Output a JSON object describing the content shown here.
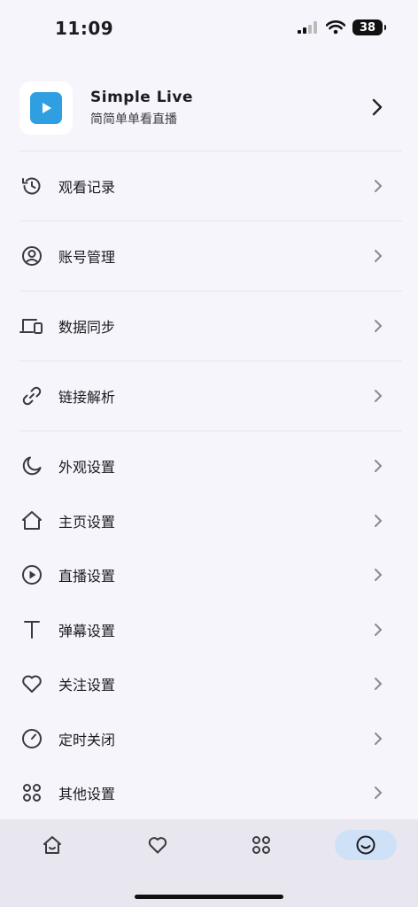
{
  "status_bar": {
    "time": "11:09",
    "battery": "38"
  },
  "app": {
    "name": "Simple Live",
    "subtitle": "简简单单看直播"
  },
  "menu": [
    {
      "label": "观看记录",
      "icon": "history-icon"
    },
    {
      "label": "账号管理",
      "icon": "account-icon"
    },
    {
      "label": "数据同步",
      "icon": "devices-icon"
    },
    {
      "label": "链接解析",
      "icon": "link-icon"
    },
    {
      "label": "外观设置",
      "icon": "moon-icon"
    },
    {
      "label": "主页设置",
      "icon": "home-icon"
    },
    {
      "label": "直播设置",
      "icon": "play-circle-icon"
    },
    {
      "label": "弹幕设置",
      "icon": "text-icon"
    },
    {
      "label": "关注设置",
      "icon": "heart-icon"
    },
    {
      "label": "定时关闭",
      "icon": "timer-icon"
    },
    {
      "label": "其他设置",
      "icon": "apps-icon"
    }
  ],
  "tab_bar": {
    "tabs": [
      {
        "icon": "home-tab-icon",
        "active": false
      },
      {
        "icon": "heart-tab-icon",
        "active": false
      },
      {
        "icon": "category-tab-icon",
        "active": false
      },
      {
        "icon": "smile-tab-icon",
        "active": true
      }
    ]
  },
  "colors": {
    "accent": "#2f9fe2",
    "active_tab_bg": "#cfe1f7",
    "background": "#f6f5fb"
  }
}
